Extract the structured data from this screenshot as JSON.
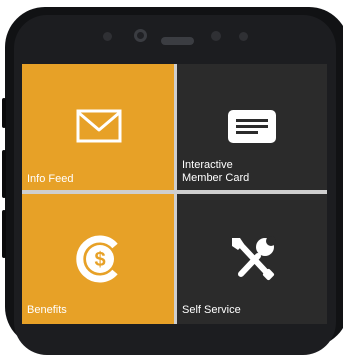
{
  "app": {
    "tiles": [
      {
        "id": "info-feed",
        "label": "Info Feed",
        "icon": "envelope-icon"
      },
      {
        "id": "member-card",
        "label": "Interactive\nMember Card",
        "icon": "member-card-icon"
      },
      {
        "id": "benefits",
        "label": "Benefits",
        "icon": "dollar-coin-icon"
      },
      {
        "id": "self-service",
        "label": "Self Service",
        "icon": "tools-icon"
      }
    ]
  },
  "colors": {
    "accent_orange": "#e7a127",
    "tile_dark": "#2b2b2b",
    "divider": "#cfcfcf",
    "phone_frame": "#111214"
  }
}
